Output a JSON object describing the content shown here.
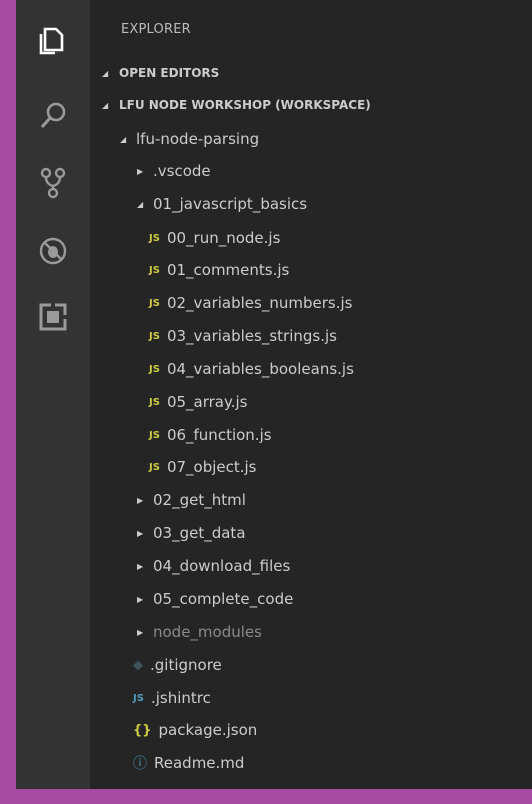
{
  "sidebar": {
    "title": "EXPLORER",
    "sections": [
      {
        "label": "OPEN EDITORS"
      },
      {
        "label": "LFU NODE WORKSHOP (WORKSPACE)"
      }
    ]
  },
  "activity_bar": [
    "files-icon",
    "search-icon",
    "source-control-icon",
    "debug-icon",
    "extensions-icon"
  ],
  "tree": [
    {
      "label": "lfu-node-parsing",
      "type": "folder-open"
    },
    {
      "label": ".vscode",
      "type": "folder"
    },
    {
      "label": "01_javascript_basics",
      "type": "folder-open"
    },
    {
      "label": "00_run_node.js",
      "icon": "JS"
    },
    {
      "label": "01_comments.js",
      "icon": "JS"
    },
    {
      "label": "02_variables_numbers.js",
      "icon": "JS"
    },
    {
      "label": "03_variables_strings.js",
      "icon": "JS"
    },
    {
      "label": "04_variables_booleans.js",
      "icon": "JS"
    },
    {
      "label": "05_array.js",
      "icon": "JS"
    },
    {
      "label": "06_function.js",
      "icon": "JS"
    },
    {
      "label": "07_object.js",
      "icon": "JS"
    },
    {
      "label": "02_get_html",
      "type": "folder"
    },
    {
      "label": "03_get_data",
      "type": "folder"
    },
    {
      "label": "04_download_files",
      "type": "folder"
    },
    {
      "label": "05_complete_code",
      "type": "folder"
    },
    {
      "label": "node_modules",
      "type": "folder"
    },
    {
      "label": ".gitignore",
      "icon": "◆"
    },
    {
      "label": ".jshintrc",
      "icon": "JS"
    },
    {
      "label": "package.json",
      "icon": "{}"
    },
    {
      "label": "Readme.md",
      "icon": "ⓘ"
    }
  ]
}
